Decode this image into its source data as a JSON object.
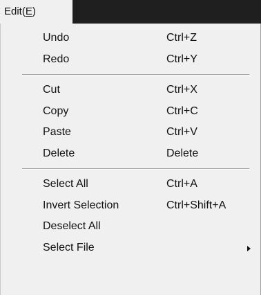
{
  "menubar": {
    "edit_label_prefix": "Edit(",
    "edit_mnemonic": "E",
    "edit_label_suffix": ")"
  },
  "menu": {
    "undo": {
      "label": "Undo",
      "shortcut": "Ctrl+Z"
    },
    "redo": {
      "label": "Redo",
      "shortcut": "Ctrl+Y"
    },
    "cut": {
      "label": "Cut",
      "shortcut": "Ctrl+X"
    },
    "copy": {
      "label": "Copy",
      "shortcut": "Ctrl+C"
    },
    "paste": {
      "label": "Paste",
      "shortcut": "Ctrl+V"
    },
    "delete": {
      "label": "Delete",
      "shortcut": "Delete"
    },
    "select_all": {
      "label": "Select All",
      "shortcut": "Ctrl+A"
    },
    "invert_selection": {
      "label": "Invert Selection",
      "shortcut": "Ctrl+Shift+A"
    },
    "deselect_all": {
      "label": "Deselect All",
      "shortcut": ""
    },
    "select_file": {
      "label": "Select File",
      "shortcut": "",
      "submenu_icon": "submenu-arrow-icon"
    }
  },
  "colors": {
    "menubar_background": "#1f1f1f",
    "menu_background": "#f0f0f0",
    "text": "#111111",
    "separator": "#a0a0a0"
  }
}
